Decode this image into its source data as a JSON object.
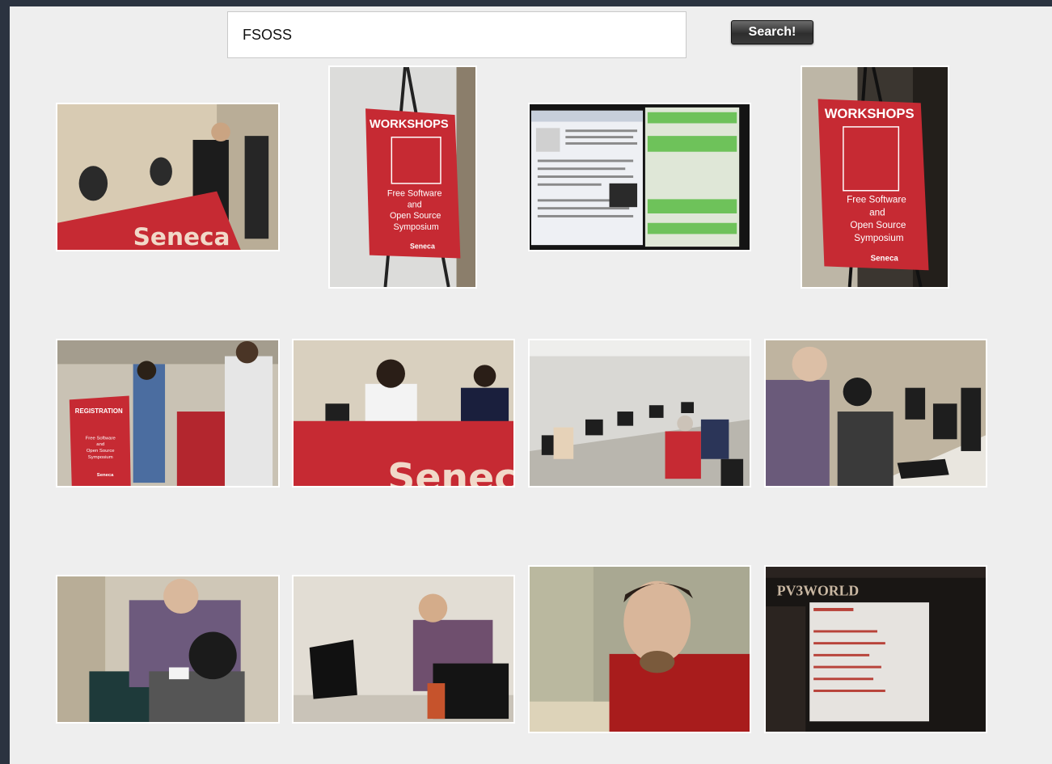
{
  "search": {
    "value": "FSOSS",
    "button_label": "Search!"
  },
  "photos": {
    "p2_title": "WORKSHOPS",
    "p2_lines": [
      "Free Software",
      "and",
      "Open Source",
      "Symposium"
    ],
    "p2_brand": "Seneca",
    "p4_title": "WORKSHOPS",
    "p4_lines": [
      "Free Software",
      "and",
      "Open Source",
      "Symposium"
    ],
    "p4_brand": "Seneca",
    "p5_sign": "REGISTRATION",
    "p5_lines": [
      "Free Software",
      "and",
      "Open Source",
      "Symposium"
    ],
    "p5_brand": "Seneca",
    "p1_table_text": "Seneca",
    "p6_table_text": "Senec",
    "p12_title": "PV3WORLD"
  },
  "colors": {
    "seneca_red": "#c62a33",
    "panel": "#eeeeee",
    "frame": "#2b3340"
  }
}
